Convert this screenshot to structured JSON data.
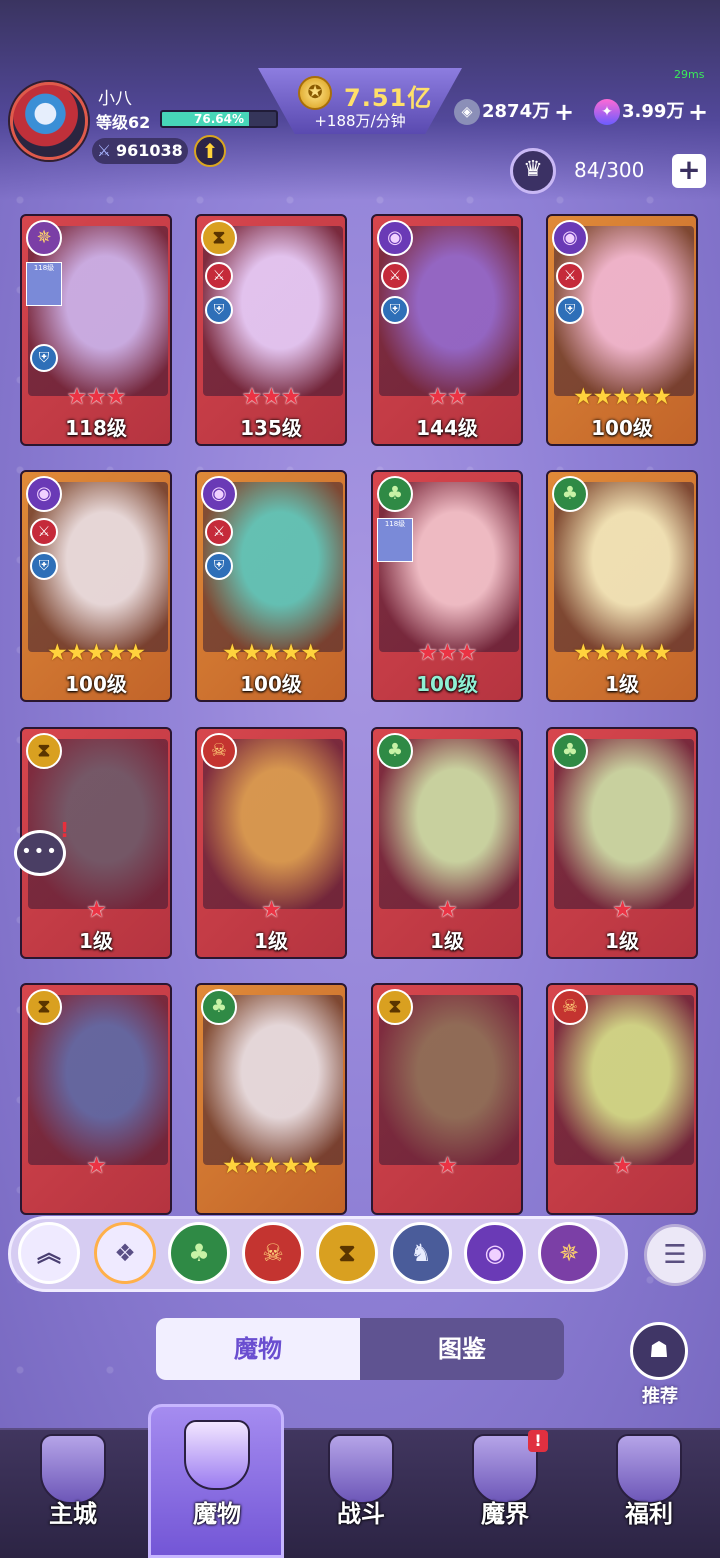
{
  "header": {
    "player_name": "小八",
    "level_label": "等级62",
    "xp_percent_label": "76.64%",
    "xp_fraction": 0.7664,
    "combat_power": "961038",
    "gold": "7.51亿",
    "gold_rate": "+188万/分钟",
    "gems": "2874万",
    "stars": "3.99万",
    "ping": "29ms",
    "monster_capacity": "84/300"
  },
  "icons": {
    "avatar": "player-avatar",
    "power": "sword-icon",
    "upgrade": "up-arrow-icon",
    "gold": "coin-icon",
    "gem": "gem-icon",
    "star": "star-crystal-icon",
    "capacity": "monster-head-icon",
    "plus": "plus-icon"
  },
  "cards": [
    {
      "element": "swirl",
      "stars": "★★★",
      "star_color": "red",
      "level": "118级",
      "frame": "red",
      "badges": true,
      "mini": true
    },
    {
      "element": "hourglass",
      "stars": "★★★",
      "star_color": "red",
      "level": "135级",
      "frame": "red",
      "badges": true,
      "mini": false
    },
    {
      "element": "eye",
      "stars": "★★",
      "star_color": "red",
      "level": "144级",
      "frame": "red",
      "badges": true,
      "mini": false
    },
    {
      "element": "eye",
      "stars": "★★★★★",
      "star_color": "gold",
      "level": "100级",
      "frame": "gold",
      "badges": true,
      "mini": false
    },
    {
      "element": "eye",
      "stars": "★★★★★",
      "star_color": "gold",
      "level": "100级",
      "frame": "gold",
      "badges": true,
      "mini": false
    },
    {
      "element": "eye",
      "stars": "★★★★★",
      "star_color": "gold",
      "level": "100级",
      "frame": "gold",
      "badges": true,
      "mini": false
    },
    {
      "element": "leaf",
      "stars": "★★★",
      "star_color": "red",
      "level": "100级",
      "frame": "red",
      "badges": false,
      "mini": true,
      "teal": true
    },
    {
      "element": "leaf",
      "stars": "★★★★★",
      "star_color": "gold",
      "level": "1级",
      "frame": "gold",
      "badges": false,
      "mini": false
    },
    {
      "element": "hourglass",
      "stars": "★",
      "star_color": "red",
      "level": "1级",
      "frame": "red",
      "badges": false,
      "mini": false
    },
    {
      "element": "demon",
      "stars": "★",
      "star_color": "red",
      "level": "1级",
      "frame": "red",
      "badges": false,
      "mini": false
    },
    {
      "element": "leaf",
      "stars": "★",
      "star_color": "red",
      "level": "1级",
      "frame": "red",
      "badges": false,
      "mini": false
    },
    {
      "element": "leaf",
      "stars": "★",
      "star_color": "red",
      "level": "1级",
      "frame": "red",
      "badges": false,
      "mini": false
    },
    {
      "element": "hourglass",
      "stars": "★",
      "star_color": "red",
      "level": "",
      "frame": "red",
      "badges": false,
      "mini": false
    },
    {
      "element": "leaf",
      "stars": "★★★★★",
      "star_color": "gold",
      "level": "",
      "frame": "gold",
      "badges": false,
      "mini": false
    },
    {
      "element": "hourglass",
      "stars": "★",
      "star_color": "red",
      "level": "",
      "frame": "red",
      "badges": false,
      "mini": false
    },
    {
      "element": "demon",
      "stars": "★",
      "star_color": "red",
      "level": "",
      "frame": "red",
      "badges": false,
      "mini": false
    }
  ],
  "card_mini_label": "118级",
  "filters": [
    {
      "name": "collapse-filter-icon",
      "glyph": "︽",
      "bg": "#efeaff",
      "fg": "#4a3f72"
    },
    {
      "name": "all-filter-icon",
      "glyph": "❖",
      "bg": "#efeaff",
      "fg": "#5a4f86"
    },
    {
      "name": "leaf-element-icon",
      "glyph": "♣",
      "bg": "#2f8a45",
      "fg": "#c7f2a6"
    },
    {
      "name": "demon-element-icon",
      "glyph": "☠",
      "bg": "#c43430",
      "fg": "#ffd27a"
    },
    {
      "name": "hourglass-element-icon",
      "glyph": "⧗",
      "bg": "#d9a020",
      "fg": "#5a3500"
    },
    {
      "name": "dragon-element-icon",
      "glyph": "♞",
      "bg": "#4a5c9a",
      "fg": "#e7ecff"
    },
    {
      "name": "eye-element-icon",
      "glyph": "◉",
      "bg": "#6a3ab6",
      "fg": "#f0d0ff"
    },
    {
      "name": "swirl-element-icon",
      "glyph": "✵",
      "bg": "#7b3fa6",
      "fg": "#ffd36a"
    }
  ],
  "tabs": {
    "monsters": "魔物",
    "codex": "图鉴"
  },
  "recommend_label": "推荐",
  "nav": [
    {
      "label": "主城",
      "icon": "castle-icon"
    },
    {
      "label": "魔物",
      "icon": "monster-flame-icon"
    },
    {
      "label": "战斗",
      "icon": "battle-shield-icon"
    },
    {
      "label": "魔界",
      "icon": "portal-icon"
    },
    {
      "label": "福利",
      "icon": "treasure-chest-icon"
    }
  ],
  "colors": {
    "accent": "#6a4ed0",
    "gold_text": "#ffe06a",
    "xp_fill": "#47d6b8"
  }
}
